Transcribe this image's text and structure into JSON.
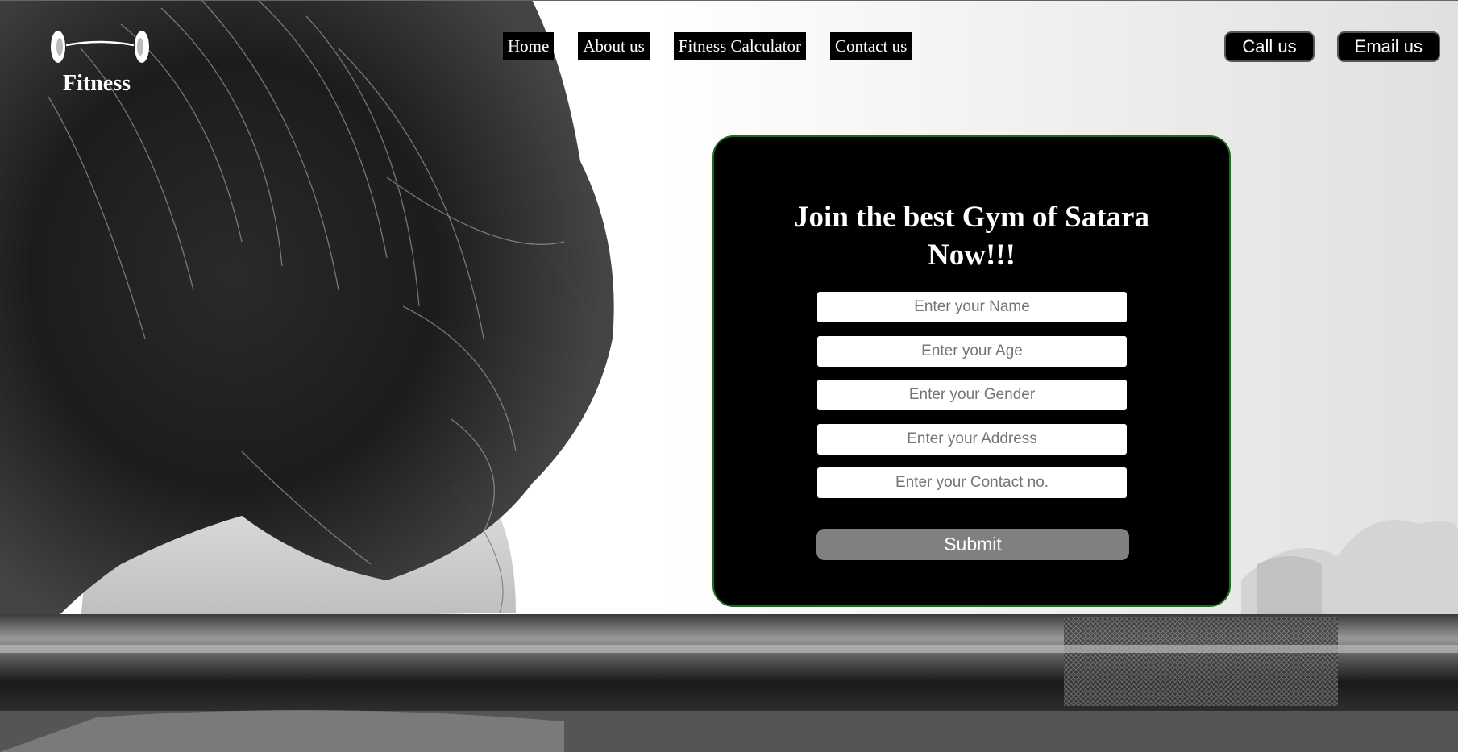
{
  "brand": {
    "name": "Fitness",
    "logo_icon": "dumbbell-icon"
  },
  "nav": {
    "items": [
      {
        "label": "Home"
      },
      {
        "label": "About us"
      },
      {
        "label": "Fitness Calculator"
      },
      {
        "label": "Contact us"
      }
    ]
  },
  "actions": {
    "call_label": "Call us",
    "email_label": "Email us"
  },
  "form": {
    "title": "Join the best Gym of Satara Now!!!",
    "fields": {
      "name_placeholder": "Enter your Name",
      "age_placeholder": "Enter your Age",
      "gender_placeholder": "Enter your Gender",
      "address_placeholder": "Enter your Address",
      "contact_placeholder": "Enter your Contact no."
    },
    "submit_label": "Submit"
  },
  "colors": {
    "card_background": "#000000",
    "card_border": "#1d6b1d",
    "submit_background": "#808080",
    "nav_background": "#000000"
  }
}
